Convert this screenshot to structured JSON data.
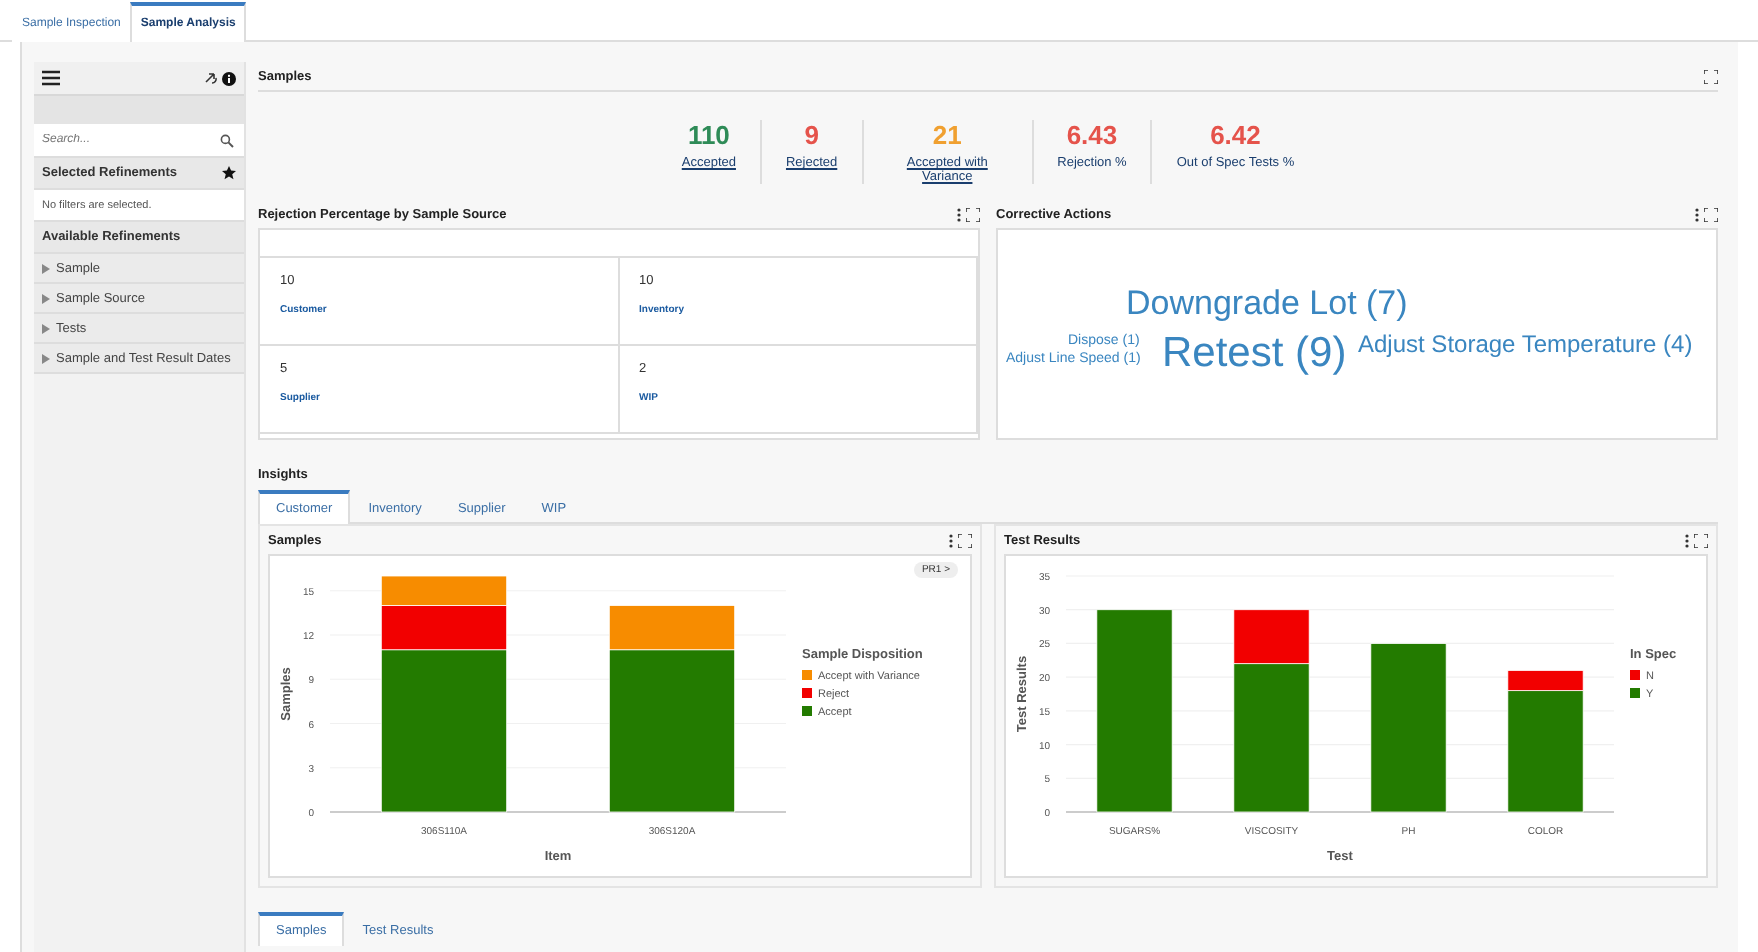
{
  "top_tabs": [
    {
      "label": "Sample Inspection",
      "selected": false
    },
    {
      "label": "Sample Analysis",
      "selected": true
    }
  ],
  "sidebar": {
    "search": {
      "placeholder": "Search..."
    },
    "selected_refinements": {
      "title": "Selected Refinements",
      "message": "No filters are selected."
    },
    "available_refinements": {
      "title": "Available Refinements",
      "items": [
        {
          "label": "Sample",
          "expanded": false
        },
        {
          "label": "Sample Source",
          "expanded": false
        },
        {
          "label": "Tests",
          "expanded": false
        },
        {
          "label": "Sample and Test Result Dates",
          "expanded": false
        }
      ]
    }
  },
  "samples": {
    "title": "Samples",
    "metrics": [
      {
        "value": "110",
        "label": "Accepted",
        "color": "#2e8b57",
        "link": true
      },
      {
        "value": "9",
        "label": "Rejected",
        "color": "#e5534b",
        "link": true
      },
      {
        "value": "21",
        "label": "Accepted with Variance",
        "color": "#f0a030",
        "link": true
      },
      {
        "value": "6.43",
        "label": "Rejection %",
        "color": "#e5534b",
        "link": false
      },
      {
        "value": "6.42",
        "label": "Out of Spec Tests %",
        "color": "#e5534b",
        "link": false
      }
    ]
  },
  "rejection": {
    "title": "Rejection Percentage by Sample Source",
    "tiles": [
      {
        "value": "10",
        "label": "Customer"
      },
      {
        "value": "10",
        "label": "Inventory"
      },
      {
        "value": "5",
        "label": "Supplier"
      },
      {
        "value": "2",
        "label": "WIP"
      }
    ]
  },
  "corrective_actions": {
    "title": "Corrective Actions",
    "words": [
      "Downgrade Lot (7)",
      "Dispose (1)",
      "Adjust Line Speed (1)",
      "Retest (9)",
      "Adjust Storage Temperature (4)"
    ]
  },
  "insights": {
    "title": "Insights",
    "tabs": [
      {
        "label": "Customer",
        "selected": true
      },
      {
        "label": "Inventory",
        "selected": false
      },
      {
        "label": "Supplier",
        "selected": false
      },
      {
        "label": "WIP",
        "selected": false
      }
    ],
    "samples_chart": {
      "title": "Samples",
      "pager": "PR1 >",
      "chart_data": {
        "type": "bar",
        "stacked": true,
        "xlabel": "Item",
        "ylabel": "Samples",
        "categories": [
          "306S110A",
          "306S120A"
        ],
        "series": [
          {
            "name": "Accept",
            "color": "#237b00",
            "values": [
              11,
              11
            ]
          },
          {
            "name": "Reject",
            "color": "#f20000",
            "values": [
              3,
              0
            ]
          },
          {
            "name": "Accept with Variance",
            "color": "#f78c00",
            "values": [
              2,
              3
            ]
          }
        ],
        "ylim": [
          0,
          16
        ],
        "yticks": [
          0,
          3,
          6,
          9,
          12,
          15
        ],
        "grid": true,
        "legend": "right",
        "legend_title": "Sample Disposition"
      }
    },
    "test_chart": {
      "title": "Test Results",
      "chart_data": {
        "type": "bar",
        "stacked": true,
        "xlabel": "Test",
        "ylabel": "Test Results",
        "categories": [
          "SUGARS%",
          "VISCOSITY",
          "PH",
          "COLOR"
        ],
        "series": [
          {
            "name": "Y",
            "color": "#237b00",
            "values": [
              30,
              22,
              25,
              18
            ]
          },
          {
            "name": "N",
            "color": "#f20000",
            "values": [
              0,
              8,
              0,
              3
            ]
          }
        ],
        "ylim": [
          0,
          35
        ],
        "yticks": [
          0,
          5,
          10,
          15,
          20,
          25,
          30,
          35
        ],
        "grid": true,
        "legend": "right",
        "legend_title": "In Spec"
      }
    }
  },
  "bottom_tabs": [
    {
      "label": "Samples",
      "selected": true
    },
    {
      "label": "Test Results",
      "selected": false
    }
  ]
}
